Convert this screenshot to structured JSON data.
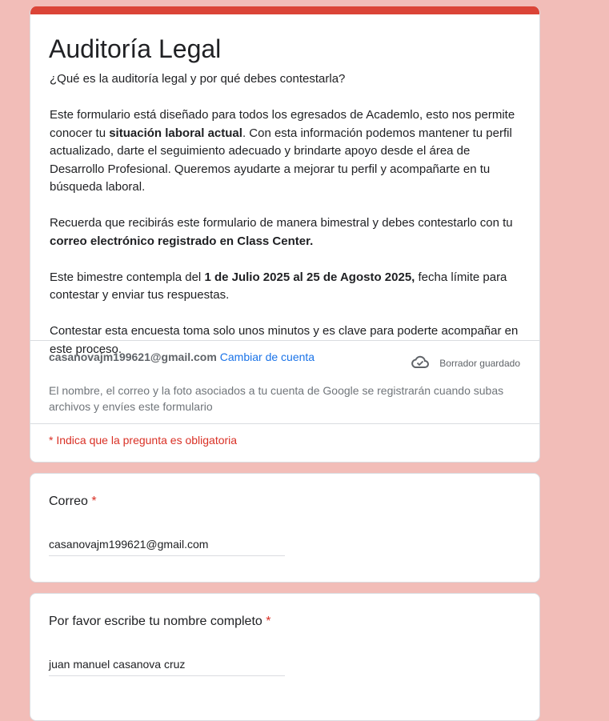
{
  "header": {
    "accent_color": "#db4437",
    "title": "Auditoría Legal",
    "description": [
      [
        {
          "t": "¿Qué es la auditoría legal y por qué debes contestarla?",
          "b": false
        }
      ],
      [
        {
          "t": "Este formulario está diseñado para todos los egresados de Academlo, esto nos permite conocer tu ",
          "b": false
        },
        {
          "t": "situación laboral actual",
          "b": true
        },
        {
          "t": ". Con esta información podemos mantener tu perfil actualizado, darte el seguimiento adecuado y brindarte apoyo desde el área de Desarrollo Profesional. Queremos ayudarte a mejorar tu perfil y acompañarte en tu búsqueda laboral.",
          "b": false
        }
      ],
      [
        {
          "t": "Recuerda que recibirás este formulario de manera bimestral y debes contestarlo con tu ",
          "b": false
        },
        {
          "t": "correo electrónico registrado en Class Center.",
          "b": true
        }
      ],
      [
        {
          "t": "Este bimestre contempla del ",
          "b": false
        },
        {
          "t": "1 de Julio 2025 al 25 de Agosto 2025,",
          "b": true
        },
        {
          "t": " fecha límite para contestar y enviar tus respuestas.",
          "b": false
        }
      ],
      [
        {
          "t": "Contestar esta encuesta toma solo unos minutos y es clave para poderte acompañar en este proceso.",
          "b": false
        }
      ]
    ]
  },
  "account": {
    "email": "casanovajm199621@gmail.com",
    "switch_label": "Cambiar de cuenta",
    "draft_icon": "cloud-check-icon",
    "draft_status": "Borrador guardado",
    "notice": "El nombre, el correo y la foto asociados a tu cuenta de Google se registrarán cuando subas archivos y envíes este formulario"
  },
  "required_note": "* Indica que la pregunta es obligatoria",
  "questions": [
    {
      "label": "Correo",
      "required_mark": "*",
      "value": "casanovajm199621@gmail.com"
    },
    {
      "label": "Por favor escribe tu nombre completo",
      "required_mark": "*",
      "value": "juan manuel casanova cruz"
    }
  ]
}
